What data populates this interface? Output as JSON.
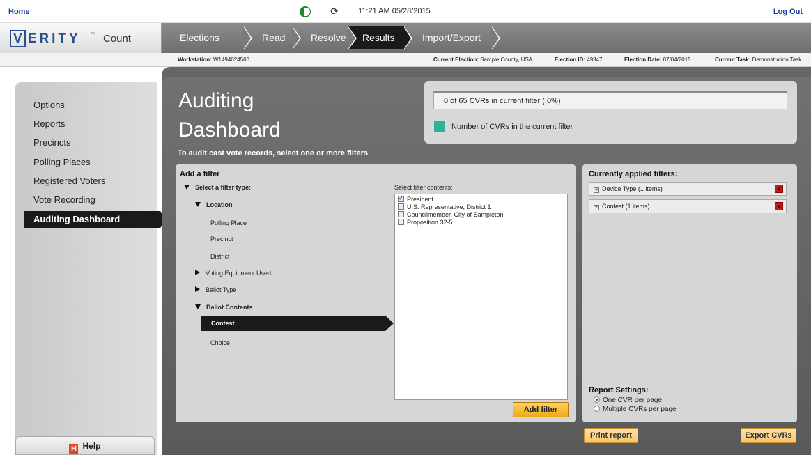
{
  "topbar": {
    "home": "Home",
    "logout": "Log Out",
    "datetime": "11:21 AM 05/28/2015",
    "status_icon_1": "connection-status-icon",
    "status_icon_2": "sync-icon"
  },
  "logo": {
    "brand_first": "V",
    "brand_rest": "ERITY",
    "tm": "™",
    "product": "Count"
  },
  "nav": {
    "tabs": [
      {
        "label": "Elections",
        "active": false
      },
      {
        "label": "Read",
        "active": false
      },
      {
        "label": "Resolve",
        "active": false
      },
      {
        "label": "Results",
        "active": true
      },
      {
        "label": "Import/Export",
        "active": false
      }
    ]
  },
  "infobar": {
    "workstation_label": "Workstation:",
    "workstation_value": "W1494024503",
    "election_label": "Current Election:",
    "election_value": "Sample County, USA",
    "election_id_label": "Election ID:",
    "election_id_value": "49347",
    "election_date_label": "Election Date:",
    "election_date_value": "07/04/2015",
    "task_label": "Current Task:",
    "task_value": "Demonstration Task"
  },
  "sidebar": {
    "items": [
      {
        "label": "Options"
      },
      {
        "label": "Reports"
      },
      {
        "label": "Precincts"
      },
      {
        "label": "Polling Places"
      },
      {
        "label": "Registered Voters"
      },
      {
        "label": "Vote Recording"
      },
      {
        "label": "Auditing Dashboard"
      }
    ],
    "help": "Help",
    "help_icon": "H"
  },
  "main": {
    "title_line1": "Auditing",
    "title_line2": "Dashboard",
    "subtitle": "To audit cast vote records, select one or more filters",
    "count_text": "0 of 65 CVRs in current filter (.0%)",
    "legend_text": "Number of CVRs in the current filter",
    "legend_color": "#2db39a"
  },
  "filter": {
    "title": "Add a filter",
    "select_type": "Select a filter type:",
    "tree": {
      "location": "Location",
      "polling_place": "Polling Place",
      "precinct": "Precinct",
      "district": "District",
      "voting_equipment": "Voting Equipment Used",
      "ballot_type": "Ballot Type",
      "ballot_contents": "Ballot Contents",
      "contest": "Contest",
      "choice": "Choice"
    },
    "contents_label": "Select filter contents:",
    "contents": [
      {
        "label": "President",
        "checked": true
      },
      {
        "label": "U.S. Representative, District 1",
        "checked": false
      },
      {
        "label": "Councilmember, City of Sampleton",
        "checked": false
      },
      {
        "label": "Proposition 32-5",
        "checked": false
      }
    ],
    "add_button": "Add filter"
  },
  "applied": {
    "title": "Currently applied filters:",
    "items": [
      {
        "label": "Device Type (1 items)"
      },
      {
        "label": "Contest (1 items)"
      }
    ],
    "remove_label": "x",
    "report_title": "Report Settings:",
    "options": [
      {
        "label": "One CVR per page",
        "selected": true
      },
      {
        "label": "Multiple CVRs per page",
        "selected": false
      }
    ],
    "print_button": "Print report",
    "export_button": "Export CVRs"
  }
}
